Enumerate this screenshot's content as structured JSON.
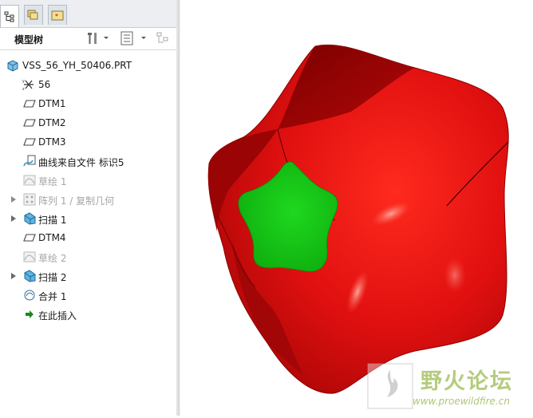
{
  "model_tree": {
    "title": "模型树",
    "items": [
      {
        "label": "VSS_56_YH_50406.PRT",
        "icon": "part-icon",
        "disabled": false,
        "expandable": false
      },
      {
        "label": "56",
        "icon": "csys-icon",
        "disabled": false,
        "expandable": false
      },
      {
        "label": "DTM1",
        "icon": "datum-plane-icon",
        "disabled": false,
        "expandable": false
      },
      {
        "label": "DTM2",
        "icon": "datum-plane-icon",
        "disabled": false,
        "expandable": false
      },
      {
        "label": "DTM3",
        "icon": "datum-plane-icon",
        "disabled": false,
        "expandable": false
      },
      {
        "label": "曲线来自文件 标识5",
        "icon": "curve-from-file-icon",
        "disabled": false,
        "expandable": false
      },
      {
        "label": "草绘 1",
        "icon": "sketch-icon",
        "disabled": true,
        "expandable": false
      },
      {
        "label": "阵列 1 / 复制几何",
        "icon": "pattern-icon",
        "disabled": true,
        "expandable": true
      },
      {
        "label": "扫描 1",
        "icon": "sweep-icon",
        "disabled": false,
        "expandable": true
      },
      {
        "label": "DTM4",
        "icon": "datum-plane-icon",
        "disabled": false,
        "expandable": false
      },
      {
        "label": "草绘 2",
        "icon": "sketch-icon",
        "disabled": true,
        "expandable": false
      },
      {
        "label": "扫描 2",
        "icon": "sweep-icon",
        "disabled": false,
        "expandable": true
      },
      {
        "label": "合并 1",
        "icon": "merge-icon",
        "disabled": false,
        "expandable": false
      },
      {
        "label": "在此插入",
        "icon": "insert-here-arrow-icon",
        "disabled": false,
        "expandable": false
      }
    ]
  },
  "tabs": [
    {
      "name": "model-tree-tab",
      "icon": "tree-icon"
    },
    {
      "name": "folder-browser-tab",
      "icon": "folders-icon"
    },
    {
      "name": "favorites-tab",
      "icon": "favorites-folder-icon"
    }
  ],
  "watermark": {
    "title": "野火论坛",
    "url": "www.proewildfire.cn"
  },
  "colors": {
    "model_red": "#d40a0a",
    "model_green": "#12c41a",
    "sweep_icon_blue": "#2f8fc8",
    "insert_arrow_green": "#1a8a1a"
  }
}
